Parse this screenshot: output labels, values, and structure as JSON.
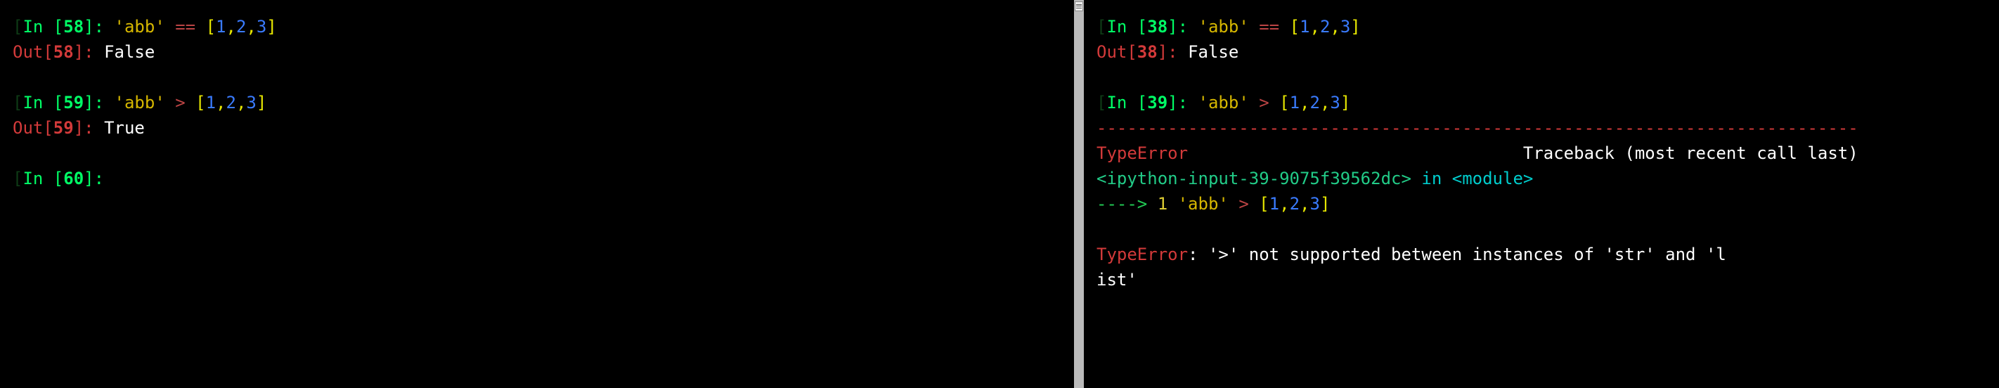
{
  "left": {
    "cells": [
      {
        "kind": "in",
        "n": "58",
        "code": {
          "str": "'abb'",
          "op": "==",
          "list": [
            "1",
            "2",
            "3"
          ]
        }
      },
      {
        "kind": "out",
        "n": "58",
        "value": "False"
      },
      {
        "kind": "blank"
      },
      {
        "kind": "in",
        "n": "59",
        "code": {
          "str": "'abb'",
          "op": ">",
          "list": [
            "1",
            "2",
            "3"
          ]
        }
      },
      {
        "kind": "out",
        "n": "59",
        "value": "True"
      },
      {
        "kind": "blank"
      },
      {
        "kind": "in",
        "n": "60",
        "code": null
      }
    ]
  },
  "right": {
    "cells": [
      {
        "kind": "in",
        "n": "38",
        "code": {
          "str": "'abb'",
          "op": "==",
          "list": [
            "1",
            "2",
            "3"
          ]
        }
      },
      {
        "kind": "out",
        "n": "38",
        "value": "False"
      },
      {
        "kind": "blank"
      },
      {
        "kind": "in",
        "n": "39",
        "code": {
          "str": "'abb'",
          "op": ">",
          "list": [
            "1",
            "2",
            "3"
          ]
        }
      }
    ],
    "traceback": {
      "separator": "---------------------------------------------------------------------------",
      "error_name": "TypeError",
      "traceback_label": "Traceback (most recent call last)",
      "location": "<ipython-input-39-9075f39562dc>",
      "in_word": "in",
      "module": "<module>",
      "arrow": "----> ",
      "lineno": "1",
      "code": {
        "str": "'abb'",
        "op": ">",
        "list": [
          "1",
          "2",
          "3"
        ]
      },
      "error_msg_prefix": "TypeError",
      "error_msg": ": '>' not supported between instances of 'str' and 'l\nist'"
    }
  },
  "labels": {
    "in": "In ",
    "out": "Out"
  }
}
